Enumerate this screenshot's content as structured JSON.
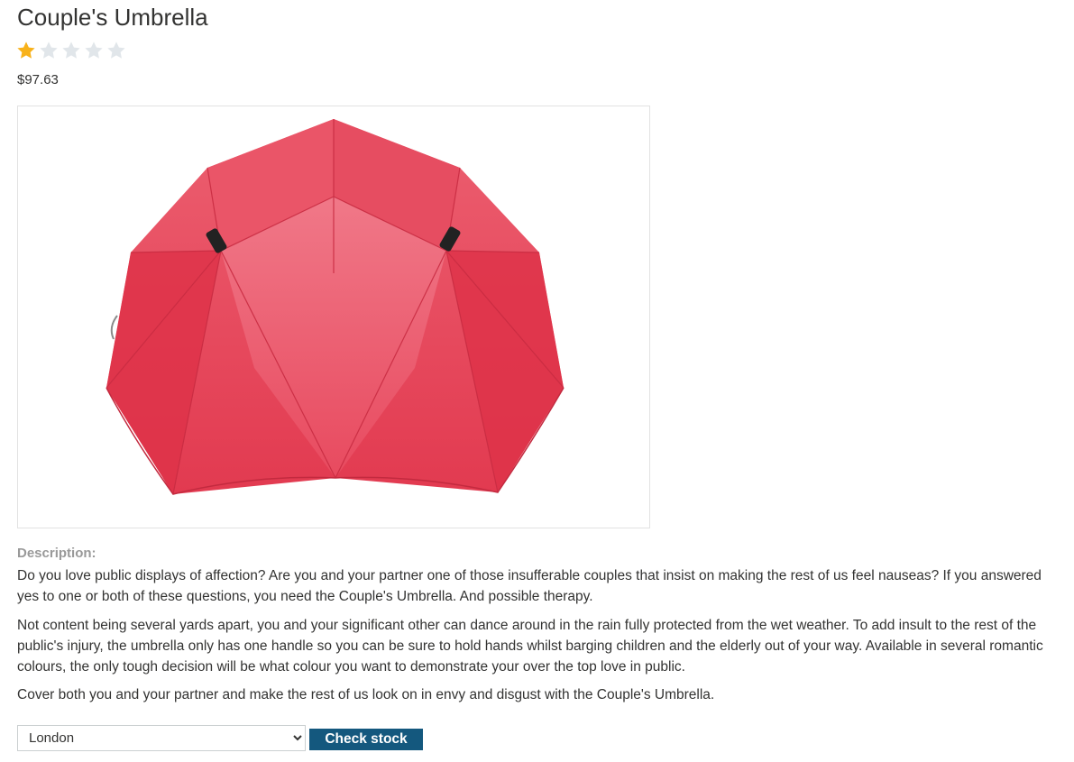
{
  "product": {
    "title": "Couple's Umbrella",
    "rating": {
      "value": 1,
      "max": 5
    },
    "price": "$97.63",
    "image_alt": "red double-canopy umbrella",
    "description_label": "Description:",
    "description": [
      "Do you love public displays of affection? Are you and your partner one of those insufferable couples that insist on making the rest of us feel nauseas? If you answered yes to one or both of these questions, you need the Couple's Umbrella. And possible therapy.",
      "Not content being several yards apart, you and your significant other can dance around in the rain fully protected from the wet weather. To add insult to the rest of the public's injury, the umbrella only has one handle so you can be sure to hold hands whilst barging children and the elderly out of your way. Available in several romantic colours, the only tough decision will be what colour you want to demonstrate your over the top love in public.",
      "Cover both you and your partner and make the rest of us look on in envy and disgust with the Couple's Umbrella."
    ]
  },
  "stock_check": {
    "selected_store": "London",
    "options": [
      "London"
    ],
    "button_label": "Check stock"
  },
  "colors": {
    "star_filled": "#f8b21b",
    "star_empty": "#e1e6ea",
    "button_bg": "#14587e",
    "umbrella": "#e8465a"
  }
}
